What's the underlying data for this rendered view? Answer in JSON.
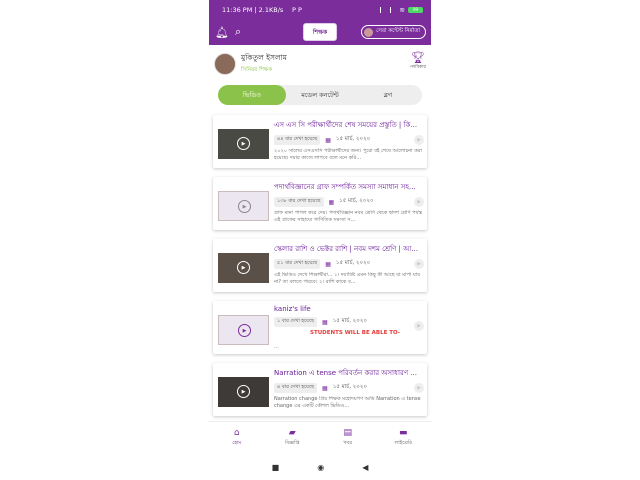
{
  "statusbar": {
    "time": "11:36 PM | 2.1KB/s",
    "pIcons": "P P",
    "battery": "99"
  },
  "appbar": {
    "logo_text": "শিক্ষক",
    "best_content_label": "সেরা কন্টেন্ট নির্মাতা"
  },
  "profile": {
    "name": "মুকিতুল ইসলাম",
    "role": "সিনিয়র শিক্ষক",
    "award_label": "পদবিকার"
  },
  "tabs": [
    {
      "label": "ভিডিও"
    },
    {
      "label": "মডেল কনটেন্ট"
    },
    {
      "label": "ব্লগ"
    }
  ],
  "videos": [
    {
      "title": "এস এস সি পরীক্ষার্থীদের শেষ সময়ের প্রস্তুতি | কি...",
      "views": "৪৪ বার দেখা হয়েছে",
      "date": "১৫ মার্চ, ২০২০",
      "desc": "২০২০ সালের এসএসসি পরীক্ষার্থীদের জন্য। পুরো বই শেষে আলোচনা করা হয়েছে। দয়ার কাজে লাগবে বলে মনে করি..."
    },
    {
      "title": "পদার্থবিজ্ঞানের গ্রাফ সম্পর্কিত সমস্যা সমাধান সহ...",
      "views": "১৩৮ বার দেখা হয়েছে",
      "date": "১৫ মার্চ, ২০২০",
      "desc": "গ্রাফ মানা পাগল করে দেয়। পদার্থবিজ্ঞান নবম শ্রেণি থেকে দ্বাদশ শ্রেণি পর্যন্ত এই গ্রাফের সাহায্যে গাণিতিক সমস্যা স..."
    },
    {
      "title": "স্কেলার রাশি ও ভেক্টর রাশি | নবম দশম শ্রেণি | আ...",
      "views": "৫১ বার দেখা হয়েছে",
      "date": "১৫ মার্চ, ২০২০",
      "desc": "এই ভিডিও দেখে শিক্ষার্থীরা... ১। দয়াবিষ্ট এমন কিছু কী আছে যা মাপা যায় না? তা বলতে পারবে। ২। রাশি কাকে ব..."
    },
    {
      "title": "kaniz's life",
      "views": "১ বার দেখা হয়েছে",
      "date": "১৫ মার্চ, ২০২০",
      "desc": "STUDENTS WILL BE ABLE TO-",
      "desc_extra": "..."
    },
    {
      "title": "Narration এ tense পরিবর্তন করার অসাধারণ ...",
      "views": "৪ বার দেখা হয়েছে",
      "date": "১৫ মার্চ, ২০২০",
      "desc": "Narration change প্রিয় শিক্ষক মহোদয়গণ আমি Narration এ tense change এর একটি কৌশল ভিডিও..."
    }
  ],
  "bottomnav": [
    {
      "label": "হোম",
      "icon": "home-icon"
    },
    {
      "label": "বিজ্ঞপ্তি",
      "icon": "notification-icon"
    },
    {
      "label": "খবর",
      "icon": "news-icon"
    },
    {
      "label": "লাইব্রেরি",
      "icon": "folder-icon"
    }
  ],
  "colors": {
    "brand": "#7b2d9c",
    "accent": "#8bc34a"
  }
}
